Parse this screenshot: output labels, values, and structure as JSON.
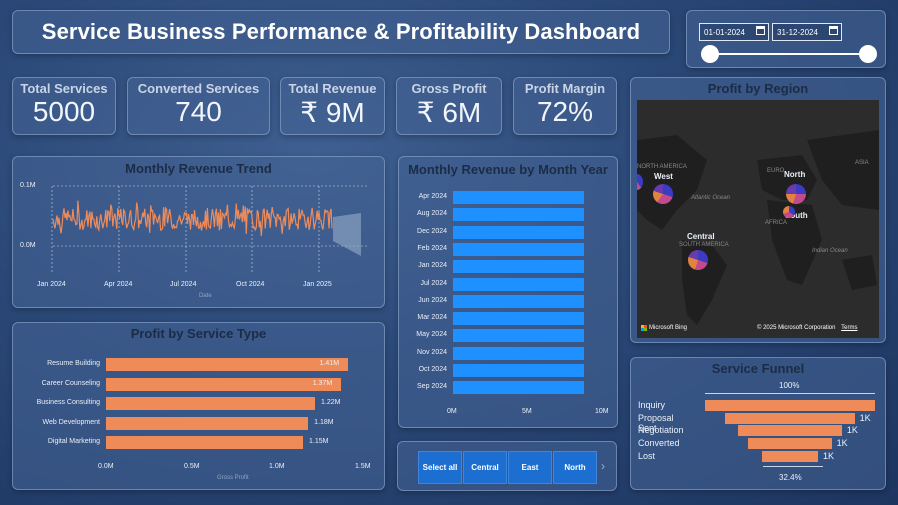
{
  "header": {
    "title": "Service Business Performance & Profitability Dashboard"
  },
  "date_filter": {
    "start": "01-01-2024",
    "end": "31-12-2024"
  },
  "kpis": [
    {
      "label": "Total Services",
      "value": "5000"
    },
    {
      "label": "Converted Services",
      "value": "740"
    },
    {
      "label": "Total Revenue",
      "value": "₹ 9M"
    },
    {
      "label": "Gross Profit",
      "value": "₹ 6M"
    },
    {
      "label": "Profit Margin",
      "value": "72%"
    }
  ],
  "revenue_trend": {
    "title": "Monthly Revenue Trend",
    "y_ticks": [
      "0.1M",
      "0.0M"
    ],
    "x_ticks": [
      "Jan 2024",
      "Apr 2024",
      "Jul 2024",
      "Oct 2024",
      "Jan 2025"
    ],
    "xlabel": "Date"
  },
  "monthly_revenue": {
    "title": "Monthly Revenue by Month Year",
    "x_ticks": [
      "0M",
      "5M",
      "10M"
    ]
  },
  "profit_service": {
    "title": "Profit by Service Type",
    "x_ticks": [
      "0.0M",
      "0.5M",
      "1.0M",
      "1.5M"
    ],
    "xlabel": "Gross Profit"
  },
  "region_map": {
    "title": "Profit by Region",
    "labels": {
      "west": "West",
      "north": "North",
      "central": "Central",
      "south": "South"
    },
    "geo": {
      "north_america": "NORTH AMERICA",
      "europe": "EURO",
      "asia": "ASIA",
      "south_america": "SOUTH AMERICA",
      "africa": "AFRICA",
      "atlantic": "Atlantic Ocean",
      "indian": "Indian Ocean"
    },
    "attribution": "Microsoft Bing",
    "copyright": "© 2025 Microsoft Corporation",
    "terms": "Terms"
  },
  "region_slicer": {
    "items": [
      "Select all",
      "Central",
      "East",
      "North"
    ]
  },
  "funnel": {
    "title": "Service Funnel",
    "top_pct": "100%",
    "bottom_pct": "32.4%",
    "stages": [
      {
        "label": "Inquiry",
        "value": "",
        "width": 1.0
      },
      {
        "label": "Proposal Sent",
        "value": "1K",
        "width": 0.76
      },
      {
        "label": "Negotiation",
        "value": "1K",
        "width": 0.61
      },
      {
        "label": "Converted",
        "value": "1K",
        "width": 0.49
      },
      {
        "label": "Lost",
        "value": "1K",
        "width": 0.33
      }
    ]
  },
  "colors": {
    "orange": "#ee8b59",
    "blue_bar": "#1e90ff",
    "panel": "#46648f"
  },
  "chart_data": [
    {
      "type": "bar",
      "title": "Monthly Revenue by Month Year",
      "orientation": "horizontal",
      "categories": [
        "Apr 2024",
        "Aug 2024",
        "Dec 2024",
        "Feb 2024",
        "Jan 2024",
        "Jul 2024",
        "Jun 2024",
        "Mar 2024",
        "May 2024",
        "Nov 2024",
        "Oct 2024",
        "Sep 2024"
      ],
      "values": [
        8.8,
        8.8,
        8.8,
        8.8,
        8.8,
        8.8,
        8.8,
        8.8,
        8.8,
        8.8,
        8.8,
        8.8
      ],
      "xlim": [
        0,
        10
      ]
    },
    {
      "type": "bar",
      "title": "Profit by Service Type",
      "orientation": "horizontal",
      "categories": [
        "Resume Building",
        "Career Counseling",
        "Business Consulting",
        "Web Development",
        "Digital Marketing"
      ],
      "values": [
        1.41,
        1.37,
        1.22,
        1.18,
        1.15
      ],
      "data_labels": [
        "1.41M",
        "1.37M",
        "1.22M",
        "1.18M",
        "1.15M"
      ],
      "xlabel": "Gross Profit",
      "xlim": [
        0,
        1.5
      ]
    }
  ]
}
